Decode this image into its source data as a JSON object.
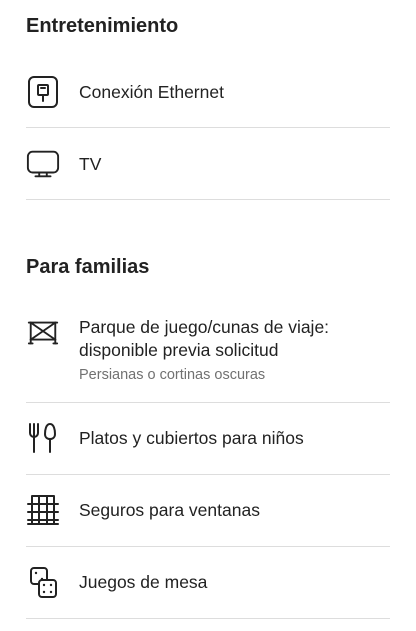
{
  "sections": [
    {
      "title": "Entretenimiento",
      "items": [
        {
          "icon": "ethernet-icon",
          "label": "Conexión Ethernet"
        },
        {
          "icon": "tv-icon",
          "label": "TV"
        }
      ]
    },
    {
      "title": "Para familias",
      "items": [
        {
          "icon": "crib-icon",
          "label": "Parque de juego/cunas de viaje: disponible previa solicitud",
          "sub": "Persianas o cortinas oscuras"
        },
        {
          "icon": "utensils-icon",
          "label": "Platos y cubiertos para niños"
        },
        {
          "icon": "window-guard-icon",
          "label": "Seguros para ventanas"
        },
        {
          "icon": "dice-icon",
          "label": "Juegos de mesa"
        }
      ]
    }
  ],
  "colors": {
    "text": "#222222",
    "secondary_text": "#717171",
    "divider": "#dddddd",
    "background": "#ffffff"
  }
}
